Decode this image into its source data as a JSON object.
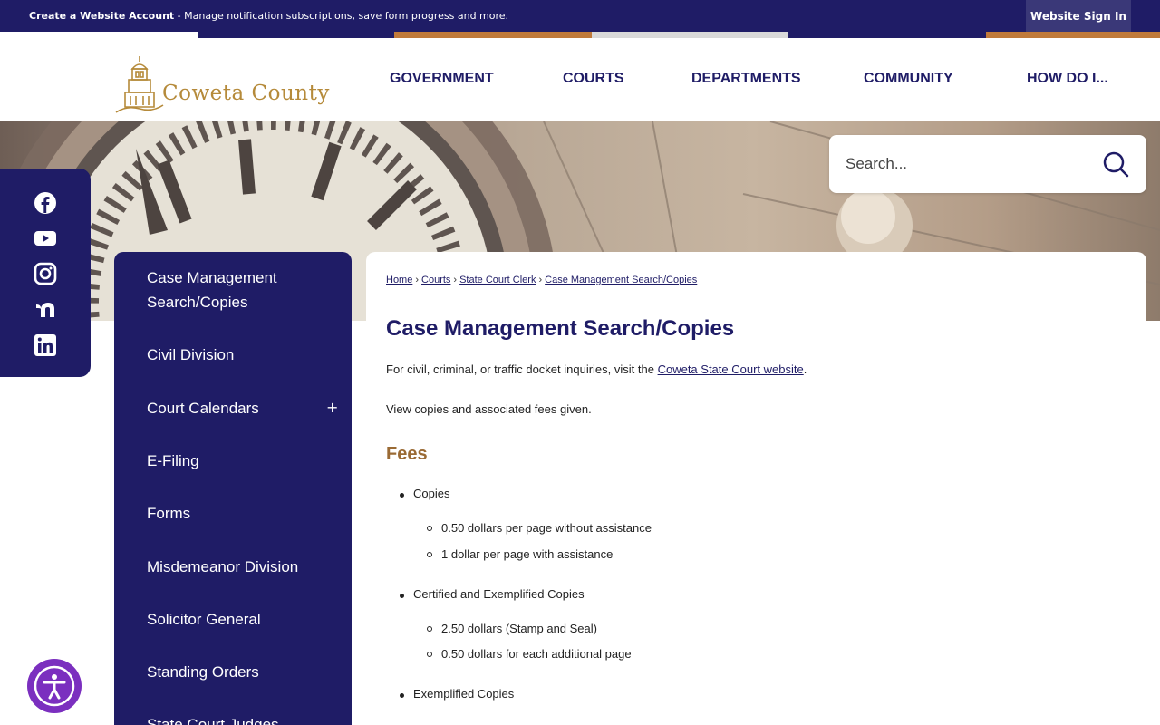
{
  "topbar": {
    "account_link": "Create a Website Account",
    "account_desc": " - Manage notification subscriptions, save form progress and more.",
    "signin": "Website Sign In"
  },
  "colors": {
    "navy": "#1f1c66",
    "gold": "#b58a3a",
    "heading_gold": "#9a6a34",
    "stripe_orange": "#c07a3a",
    "a11y_purple": "#7b2fbf"
  },
  "logo": {
    "text": "Coweta County"
  },
  "nav": {
    "items": [
      {
        "label": "GOVERNMENT"
      },
      {
        "label": "COURTS"
      },
      {
        "label": "DEPARTMENTS"
      },
      {
        "label": "COMMUNITY"
      },
      {
        "label": "HOW DO I..."
      }
    ]
  },
  "search": {
    "placeholder": "Search..."
  },
  "social": [
    "facebook-icon",
    "youtube-icon",
    "instagram-icon",
    "nextdoor-icon",
    "linkedin-icon"
  ],
  "sidebar": {
    "items": [
      {
        "label": "Case Management Search/Copies"
      },
      {
        "label": "Civil Division"
      },
      {
        "label": "Court Calendars",
        "expand": "+"
      },
      {
        "label": "E-Filing"
      },
      {
        "label": "Forms"
      },
      {
        "label": "Misdemeanor Division"
      },
      {
        "label": "Solicitor General"
      },
      {
        "label": "Standing Orders"
      },
      {
        "label": "State Court Judges"
      }
    ]
  },
  "breadcrumb": {
    "items": [
      "Home",
      "Courts",
      "State Court Clerk",
      "Case Management Search/Copies"
    ],
    "separator": "›"
  },
  "content": {
    "title": "Case Management Search/Copies",
    "intro_before": "For civil, criminal, or traffic docket inquiries, visit the ",
    "intro_link": "Coweta State Court website",
    "intro_after": ".",
    "view": "View copies and associated fees given.",
    "fees_heading": "Fees",
    "fees": [
      {
        "label": "Copies",
        "sub": [
          "0.50 dollars per page without assistance",
          "1 dollar per page with assistance"
        ]
      },
      {
        "label": "Certified and Exemplified Copies",
        "sub": [
          "2.50 dollars (Stamp and Seal)",
          "0.50 dollars for each additional page"
        ]
      },
      {
        "label": "Exemplified Copies",
        "sub": []
      }
    ]
  }
}
